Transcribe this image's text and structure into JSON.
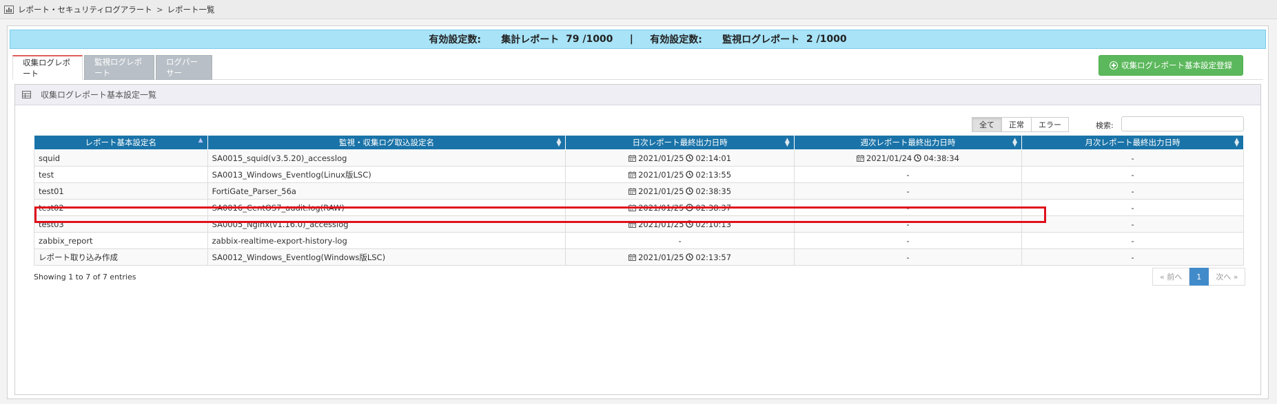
{
  "breadcrumb": {
    "section": "レポート・セキュリティログアラート",
    "separator": ">",
    "current": "レポート一覧"
  },
  "summary": {
    "label1": "有効設定数:",
    "item1_name": "集計レポート",
    "item1_value": "79 /1000",
    "divider": "|",
    "label2": "有効設定数:",
    "item2_name": "監視ログレポート",
    "item2_value": "2 /1000"
  },
  "tabs": [
    {
      "label": "収集ログレポート",
      "active": true
    },
    {
      "label": "監視ログレポート",
      "active": false
    },
    {
      "label": "ログパーサー",
      "active": false
    }
  ],
  "register_button": "収集ログレポート基本設定登録",
  "panel_title": "収集ログレポート基本設定一覧",
  "filters": [
    "全て",
    "正常",
    "エラー"
  ],
  "search": {
    "label": "検索:",
    "value": ""
  },
  "table": {
    "headers": [
      "レポート基本設定名",
      "監視・収集ログ取込設定名",
      "日次レポート最終出力日時",
      "週次レポート最終出力日時",
      "月次レポート最終出力日時"
    ],
    "rows": [
      {
        "name": "squid",
        "source": "SA0015_squid(v3.5.20)_accesslog",
        "daily_date": "2021/01/25",
        "daily_time": "02:14:01",
        "weekly_date": "2021/01/24",
        "weekly_time": "04:38:34",
        "monthly": "-"
      },
      {
        "name": "test",
        "source": "SA0013_Windows_Eventlog(Linux版LSC)",
        "daily_date": "2021/01/25",
        "daily_time": "02:13:55",
        "weekly": "-",
        "monthly": "-"
      },
      {
        "name": "test01",
        "source": "FortiGate_Parser_56a",
        "daily_date": "2021/01/25",
        "daily_time": "02:38:35",
        "weekly": "-",
        "monthly": "-"
      },
      {
        "name": "test02",
        "source": "SA0016_CentOS7_audit.log(RAW)",
        "daily_date": "2021/01/25",
        "daily_time": "02:38:37",
        "weekly": "-",
        "monthly": "-"
      },
      {
        "name": "test03",
        "source": "SA0005_Nginx(v1.16.0)_accesslog",
        "daily_date": "2021/01/25",
        "daily_time": "02:10:13",
        "weekly": "-",
        "monthly": "-"
      },
      {
        "name": "zabbix_report",
        "source": "zabbix-realtime-export-history-log",
        "daily": "-",
        "weekly": "-",
        "monthly": "-"
      },
      {
        "name": "レポート取り込み作成",
        "source": "SA0012_Windows_Eventlog(Windows版LSC)",
        "daily_date": "2021/01/25",
        "daily_time": "02:13:57",
        "weekly": "-",
        "monthly": "-"
      }
    ]
  },
  "info_text": "Showing 1 to 7 of 7 entries",
  "pagination": {
    "prev": "« 前へ",
    "current": "1",
    "next": "次へ »"
  },
  "colors": {
    "header_blue": "#1a73a8",
    "summary_bg": "#a8e3f7",
    "register_green": "#5cb85c",
    "highlight_red": "#e0101c",
    "active_tab_accent": "#e05b5b"
  }
}
